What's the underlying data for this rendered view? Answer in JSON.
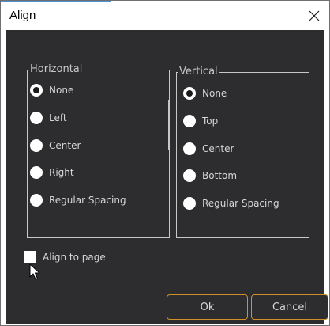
{
  "window": {
    "title": "Align",
    "close_icon": "close-icon"
  },
  "horizontal": {
    "legend": "Horizontal",
    "options": [
      {
        "label": "None",
        "checked": true
      },
      {
        "label": "Left",
        "checked": false
      },
      {
        "label": "Center",
        "checked": false
      },
      {
        "label": "Right",
        "checked": false
      },
      {
        "label": "Regular Spacing",
        "checked": false
      }
    ]
  },
  "vertical": {
    "legend": "Vertical",
    "options": [
      {
        "label": "None",
        "checked": true
      },
      {
        "label": "Top",
        "checked": false
      },
      {
        "label": "Center",
        "checked": false
      },
      {
        "label": "Bottom",
        "checked": false
      },
      {
        "label": "Regular Spacing",
        "checked": false
      }
    ]
  },
  "align_to_page": {
    "label": "Align to page",
    "checked": false
  },
  "buttons": {
    "ok": "Ok",
    "cancel": "Cancel"
  },
  "colors": {
    "background": "#2d2d30",
    "text": "#d6d6d6",
    "button_border": "#d0902a",
    "accent": "#4d8fd4"
  }
}
